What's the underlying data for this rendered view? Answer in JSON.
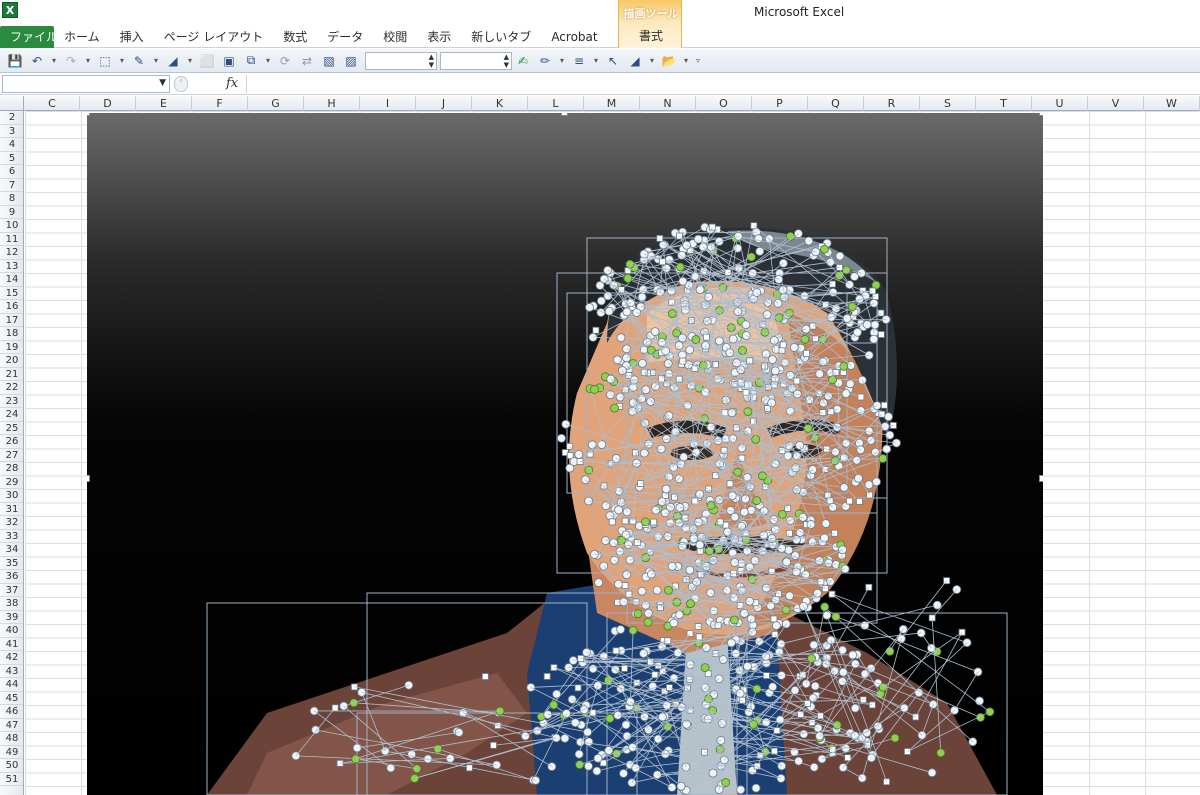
{
  "app": {
    "title": "Microsoft Excel",
    "icon_label": "X"
  },
  "ribbon": {
    "tabs": [
      "ファイル",
      "ホーム",
      "挿入",
      "ページ レイアウト",
      "数式",
      "データ",
      "校閲",
      "表示",
      "新しいタブ",
      "Acrobat"
    ],
    "context_group": "描画ツール",
    "context_tab": "書式"
  },
  "formula_bar": {
    "name_box": "",
    "fx_label": "fx",
    "formula": ""
  },
  "columns": [
    "C",
    "D",
    "E",
    "F",
    "G",
    "H",
    "I",
    "J",
    "K",
    "L",
    "M",
    "N",
    "O",
    "P",
    "Q",
    "R",
    "S",
    "T",
    "U",
    "V",
    "W"
  ],
  "rows": [
    "2",
    "3",
    "4",
    "5",
    "6",
    "7",
    "8",
    "9",
    "10",
    "11",
    "12",
    "13",
    "14",
    "15",
    "16",
    "17",
    "18",
    "19",
    "20",
    "21",
    "22",
    "23",
    "24",
    "25",
    "26",
    "27",
    "28",
    "29",
    "30",
    "31",
    "32",
    "33",
    "34",
    "35",
    "36",
    "37",
    "38",
    "39",
    "40",
    "41",
    "42",
    "43",
    "44",
    "45",
    "46",
    "47",
    "48",
    "49",
    "50",
    "51"
  ],
  "colors": {
    "file_tab": "#2a8a3e",
    "context_group": "#f7c865",
    "skin": "#e0a37a",
    "suit": "#6b4338",
    "shirt": "#1c3f73",
    "handle_green": "#8fd14f"
  },
  "artwork": {
    "subject": "vector portrait of a man in a brown suit drawn with autoshapes, edit points shown"
  }
}
